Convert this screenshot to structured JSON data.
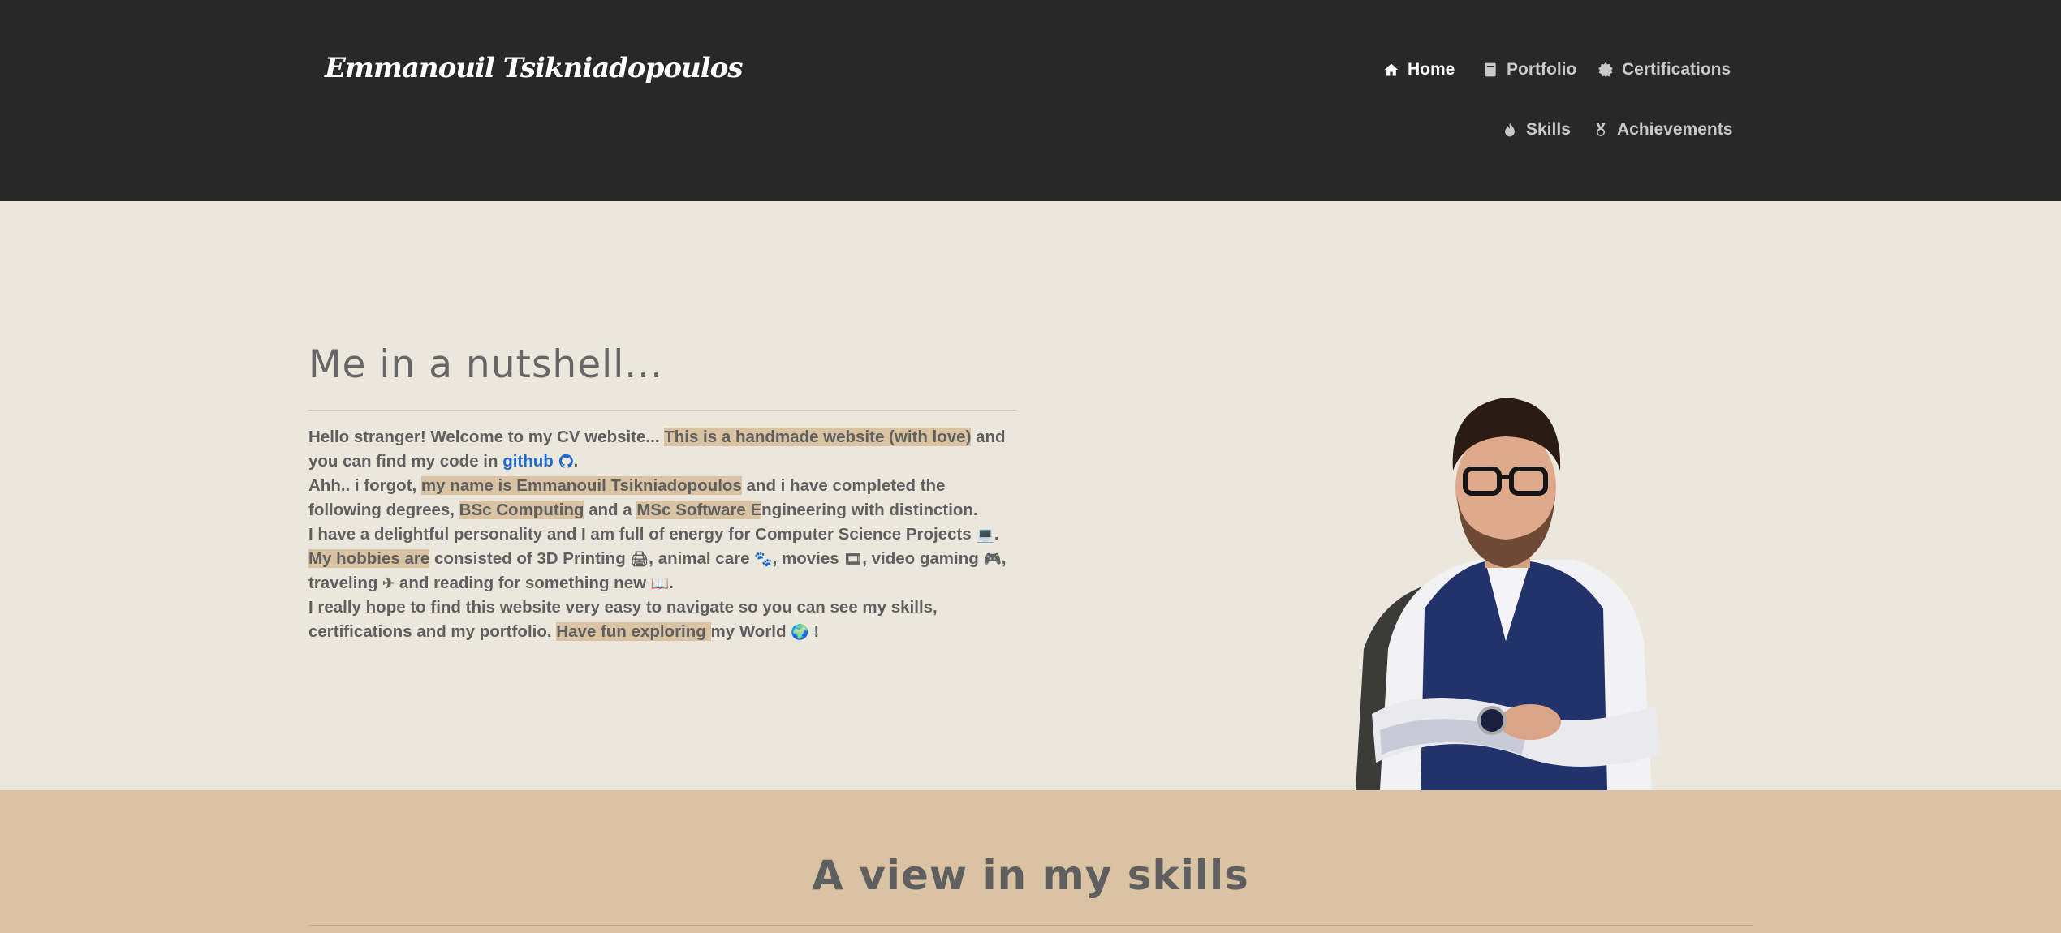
{
  "header": {
    "brand": "Emmanouil Tsikniadopoulos",
    "nav": [
      {
        "label": "Home",
        "icon": "home-icon",
        "active": true
      },
      {
        "label": "Portfolio",
        "icon": "book-icon",
        "active": false
      },
      {
        "label": "Certifications",
        "icon": "certificate-icon",
        "active": false
      },
      {
        "label": "Skills",
        "icon": "fire-icon",
        "active": false
      },
      {
        "label": "Achievements",
        "icon": "medal-icon",
        "active": false
      }
    ]
  },
  "about": {
    "title": "Me in a nutshell...",
    "p1_a": "Hello stranger! Welcome to my CV website... ",
    "p1_hl": "This is a handmade website (with love)",
    "p1_b": " and you can find my code in ",
    "p1_link": "github",
    "p1_c": ".",
    "p2_a": "Ahh.. i forgot, ",
    "p2_hl": "my name is Emmanouil Tsikniadopoulos",
    "p2_b": " and i have completed the following degrees, ",
    "p2_hl2": "BSc Computing",
    "p2_c": " and a ",
    "p2_hl3": "MSc Software E",
    "p2_d": "ngineering with distinction.",
    "p3": "I have a delightful personality and I am full of energy for Computer Science Projects",
    "p4_hl": "My hobbies are",
    "p4_a": " consisted of 3D Printing ",
    "p4_b": ", animal care ",
    "p4_c": ", movies ",
    "p4_d": ", video gaming ",
    "p4_e": ", traveling ",
    "p4_f": " and reading for something new ",
    "p5_a": "I really hope to find this website very easy to navigate so you can see my skills, certifications and my portfolio. ",
    "p5_hl": "Have fun exploring ",
    "p5_b": "my World ",
    "p5_c": " !"
  },
  "skills": {
    "title": "A view in my skills"
  },
  "colors": {
    "header_bg": "#282828",
    "page_bg": "#ebe7dd",
    "highlight": "#d9c3a3",
    "link": "#1b6ad1"
  }
}
